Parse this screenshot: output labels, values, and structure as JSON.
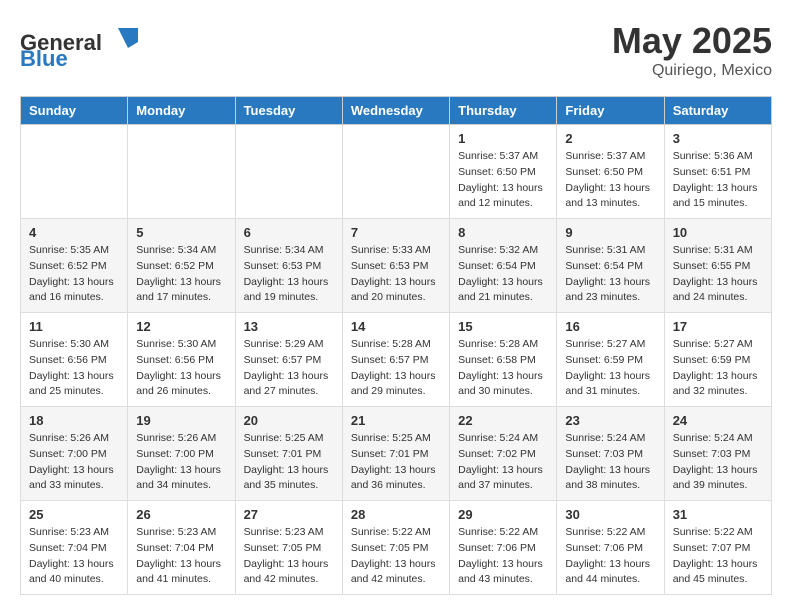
{
  "logo": {
    "text_general": "General",
    "text_blue": "Blue"
  },
  "header": {
    "month_year": "May 2025",
    "location": "Quiriego, Mexico"
  },
  "days_of_week": [
    "Sunday",
    "Monday",
    "Tuesday",
    "Wednesday",
    "Thursday",
    "Friday",
    "Saturday"
  ],
  "weeks": [
    [
      {
        "day": "",
        "info": ""
      },
      {
        "day": "",
        "info": ""
      },
      {
        "day": "",
        "info": ""
      },
      {
        "day": "",
        "info": ""
      },
      {
        "day": "1",
        "info": "Sunrise: 5:37 AM\nSunset: 6:50 PM\nDaylight: 13 hours\nand 12 minutes."
      },
      {
        "day": "2",
        "info": "Sunrise: 5:37 AM\nSunset: 6:50 PM\nDaylight: 13 hours\nand 13 minutes."
      },
      {
        "day": "3",
        "info": "Sunrise: 5:36 AM\nSunset: 6:51 PM\nDaylight: 13 hours\nand 15 minutes."
      }
    ],
    [
      {
        "day": "4",
        "info": "Sunrise: 5:35 AM\nSunset: 6:52 PM\nDaylight: 13 hours\nand 16 minutes."
      },
      {
        "day": "5",
        "info": "Sunrise: 5:34 AM\nSunset: 6:52 PM\nDaylight: 13 hours\nand 17 minutes."
      },
      {
        "day": "6",
        "info": "Sunrise: 5:34 AM\nSunset: 6:53 PM\nDaylight: 13 hours\nand 19 minutes."
      },
      {
        "day": "7",
        "info": "Sunrise: 5:33 AM\nSunset: 6:53 PM\nDaylight: 13 hours\nand 20 minutes."
      },
      {
        "day": "8",
        "info": "Sunrise: 5:32 AM\nSunset: 6:54 PM\nDaylight: 13 hours\nand 21 minutes."
      },
      {
        "day": "9",
        "info": "Sunrise: 5:31 AM\nSunset: 6:54 PM\nDaylight: 13 hours\nand 23 minutes."
      },
      {
        "day": "10",
        "info": "Sunrise: 5:31 AM\nSunset: 6:55 PM\nDaylight: 13 hours\nand 24 minutes."
      }
    ],
    [
      {
        "day": "11",
        "info": "Sunrise: 5:30 AM\nSunset: 6:56 PM\nDaylight: 13 hours\nand 25 minutes."
      },
      {
        "day": "12",
        "info": "Sunrise: 5:30 AM\nSunset: 6:56 PM\nDaylight: 13 hours\nand 26 minutes."
      },
      {
        "day": "13",
        "info": "Sunrise: 5:29 AM\nSunset: 6:57 PM\nDaylight: 13 hours\nand 27 minutes."
      },
      {
        "day": "14",
        "info": "Sunrise: 5:28 AM\nSunset: 6:57 PM\nDaylight: 13 hours\nand 29 minutes."
      },
      {
        "day": "15",
        "info": "Sunrise: 5:28 AM\nSunset: 6:58 PM\nDaylight: 13 hours\nand 30 minutes."
      },
      {
        "day": "16",
        "info": "Sunrise: 5:27 AM\nSunset: 6:59 PM\nDaylight: 13 hours\nand 31 minutes."
      },
      {
        "day": "17",
        "info": "Sunrise: 5:27 AM\nSunset: 6:59 PM\nDaylight: 13 hours\nand 32 minutes."
      }
    ],
    [
      {
        "day": "18",
        "info": "Sunrise: 5:26 AM\nSunset: 7:00 PM\nDaylight: 13 hours\nand 33 minutes."
      },
      {
        "day": "19",
        "info": "Sunrise: 5:26 AM\nSunset: 7:00 PM\nDaylight: 13 hours\nand 34 minutes."
      },
      {
        "day": "20",
        "info": "Sunrise: 5:25 AM\nSunset: 7:01 PM\nDaylight: 13 hours\nand 35 minutes."
      },
      {
        "day": "21",
        "info": "Sunrise: 5:25 AM\nSunset: 7:01 PM\nDaylight: 13 hours\nand 36 minutes."
      },
      {
        "day": "22",
        "info": "Sunrise: 5:24 AM\nSunset: 7:02 PM\nDaylight: 13 hours\nand 37 minutes."
      },
      {
        "day": "23",
        "info": "Sunrise: 5:24 AM\nSunset: 7:03 PM\nDaylight: 13 hours\nand 38 minutes."
      },
      {
        "day": "24",
        "info": "Sunrise: 5:24 AM\nSunset: 7:03 PM\nDaylight: 13 hours\nand 39 minutes."
      }
    ],
    [
      {
        "day": "25",
        "info": "Sunrise: 5:23 AM\nSunset: 7:04 PM\nDaylight: 13 hours\nand 40 minutes."
      },
      {
        "day": "26",
        "info": "Sunrise: 5:23 AM\nSunset: 7:04 PM\nDaylight: 13 hours\nand 41 minutes."
      },
      {
        "day": "27",
        "info": "Sunrise: 5:23 AM\nSunset: 7:05 PM\nDaylight: 13 hours\nand 42 minutes."
      },
      {
        "day": "28",
        "info": "Sunrise: 5:22 AM\nSunset: 7:05 PM\nDaylight: 13 hours\nand 42 minutes."
      },
      {
        "day": "29",
        "info": "Sunrise: 5:22 AM\nSunset: 7:06 PM\nDaylight: 13 hours\nand 43 minutes."
      },
      {
        "day": "30",
        "info": "Sunrise: 5:22 AM\nSunset: 7:06 PM\nDaylight: 13 hours\nand 44 minutes."
      },
      {
        "day": "31",
        "info": "Sunrise: 5:22 AM\nSunset: 7:07 PM\nDaylight: 13 hours\nand 45 minutes."
      }
    ]
  ]
}
